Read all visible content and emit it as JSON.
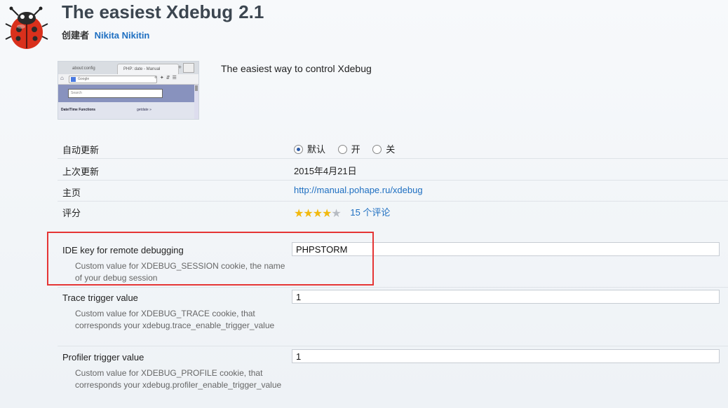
{
  "addon": {
    "title": "The easiest Xdebug",
    "version": "2.1",
    "creator_label": "创建者",
    "creator_name": "Nikita Nikitin",
    "description": "The easiest way to control Xdebug",
    "icon": "ladybug-icon"
  },
  "thumbnail": {
    "tab1": "about:config",
    "tab2": "PHP: date - Manual",
    "plus": "+",
    "search_engine": "Google",
    "page_search_placeholder": "Search",
    "section": "Date/Time Functions",
    "link": "getdate »"
  },
  "details": [
    {
      "label": "自动更新"
    },
    {
      "label": "上次更新",
      "value": "2015年4月21日"
    },
    {
      "label": "主页",
      "value": "http://manual.pohape.ru/xdebug"
    },
    {
      "label": "评分",
      "value": "15 个评论"
    }
  ],
  "auto_update": {
    "options": [
      "默认",
      "开",
      "关"
    ],
    "selected": "默认"
  },
  "rating": {
    "stars": 4,
    "max": 5
  },
  "prefs": [
    {
      "label": "IDE key for remote debugging",
      "description": "Custom value for XDEBUG_SESSION cookie, the name of your debug session",
      "value": "PHPSTORM"
    },
    {
      "label": "Trace trigger value",
      "description": "Custom value for XDEBUG_TRACE cookie, that corresponds your xdebug.trace_enable_trigger_value",
      "value": "1"
    },
    {
      "label": "Profiler trigger value",
      "description": "Custom value for XDEBUG_PROFILE cookie, that corresponds your xdebug.profiler_enable_trigger_value",
      "value": "1"
    }
  ],
  "colors": {
    "link": "#1e6fc1",
    "highlight_border": "#e53535",
    "star": "#f2b90f"
  }
}
